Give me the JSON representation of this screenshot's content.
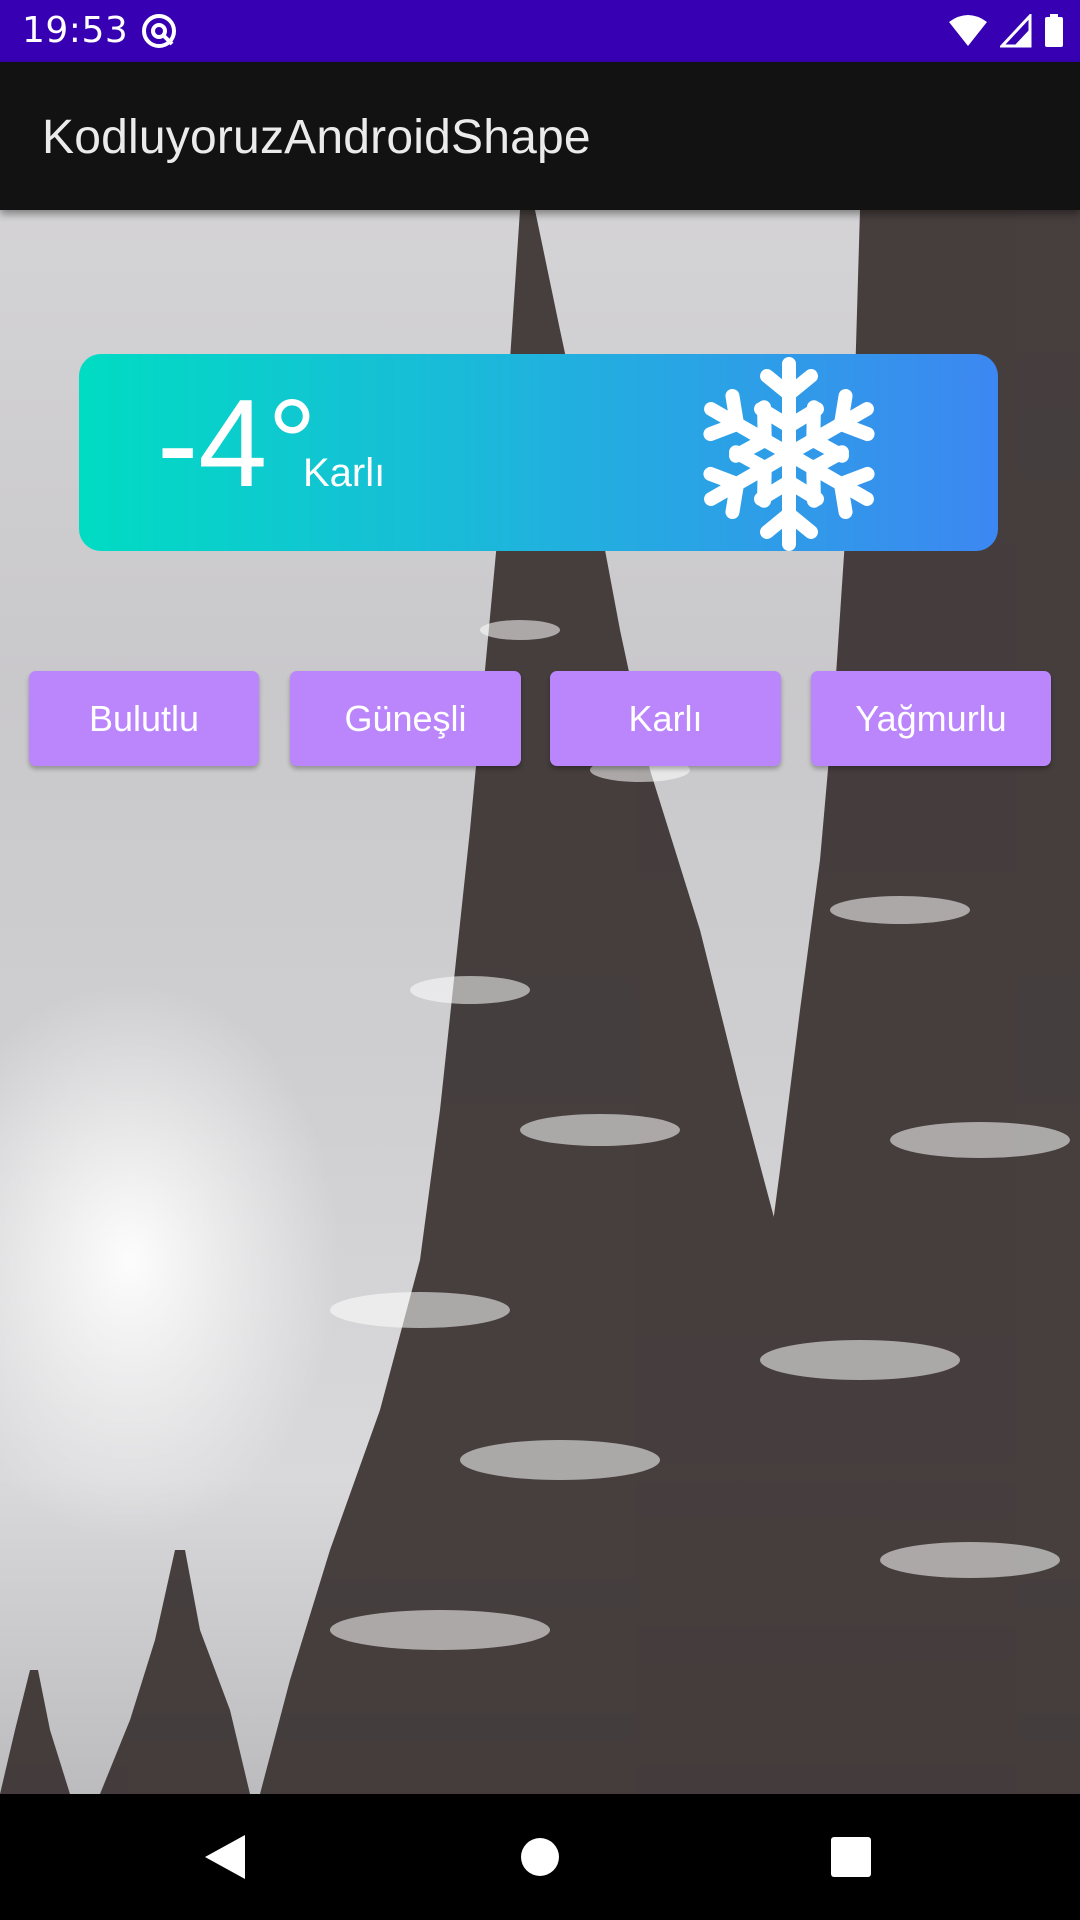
{
  "status_bar": {
    "time": "19:53",
    "icons": [
      "at-sign-icon",
      "wifi-icon",
      "cellular-signal-icon",
      "battery-icon"
    ],
    "background_color": "#3700b3"
  },
  "app_bar": {
    "title": "KodluyoruzAndroidShape",
    "background_color": "#121212"
  },
  "weather_card": {
    "temperature": "-4°",
    "condition": "Karlı",
    "icon": "snowflake-icon",
    "gradient_colors": [
      "#00dcc3",
      "#3d87f2"
    ]
  },
  "buttons": [
    {
      "label": "Bulutlu"
    },
    {
      "label": "Güneşli"
    },
    {
      "label": "Karlı"
    },
    {
      "label": "Yağmurlu"
    }
  ],
  "button_color": "#bb86fc",
  "nav_bar": {
    "items": [
      "back-icon",
      "home-icon",
      "recents-icon"
    ]
  }
}
